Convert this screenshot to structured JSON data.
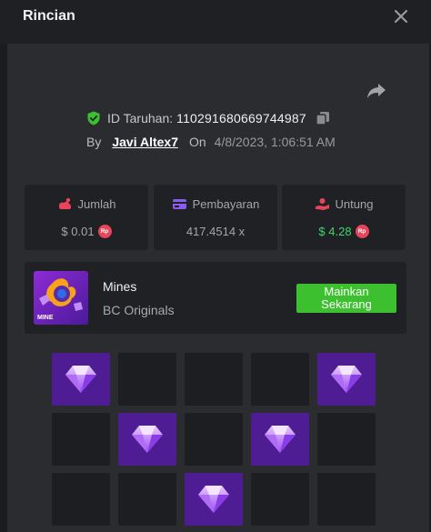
{
  "modal": {
    "title": "Rincian",
    "close_label": "×"
  },
  "bet": {
    "id_label": "ID Taruhan:",
    "id_value": "110291680669744987",
    "by_label": "By",
    "username": "Javi Altex7",
    "on_label": "On",
    "datetime": "4/8/2023, 1:06:51 AM"
  },
  "stats": [
    {
      "label": "Jumlah",
      "value": "$ 0.01",
      "currency_badge": "Rp",
      "icon": "money-bag-icon",
      "color": "#e8455a"
    },
    {
      "label": "Pembayaran",
      "value": "417.4514 x",
      "icon": "payout-card-icon",
      "color": "#8a5cf0"
    },
    {
      "label": "Untung",
      "value": "$ 4.28",
      "currency_badge": "Rp",
      "icon": "profit-hand-icon",
      "color": "#e8455a",
      "value_color": "#3fd46c"
    }
  ],
  "game": {
    "name": "Mines",
    "provider": "BC Originals",
    "thumb_label": "MINE",
    "play_label_line1": "Mainkan",
    "play_label_line2": "Sekarang"
  },
  "board": {
    "rows": 3,
    "cols": 5,
    "cells": [
      "gem",
      "empty",
      "empty",
      "empty",
      "gem",
      "empty",
      "gem",
      "empty",
      "gem",
      "empty",
      "empty",
      "empty",
      "gem",
      "empty",
      "empty"
    ]
  },
  "colors": {
    "accent_green": "#3cc02f",
    "gem_bg": "#4e1c93",
    "badge_red": "#e8455a"
  }
}
